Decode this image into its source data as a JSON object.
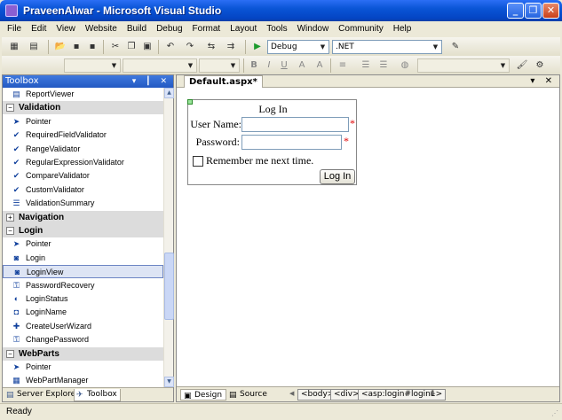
{
  "window": {
    "title": "PraveenAlwar - Microsoft Visual Studio",
    "minimize": "_",
    "maximize": "❐",
    "close": "✕"
  },
  "menu": [
    "File",
    "Edit",
    "View",
    "Website",
    "Build",
    "Debug",
    "Format",
    "Layout",
    "Tools",
    "Window",
    "Community",
    "Help"
  ],
  "toolbar": {
    "config_value": "Debug",
    "platform_value": ".NET",
    "bold": "B",
    "italic": "I",
    "underline": "U"
  },
  "toolbox": {
    "title": "Toolbox",
    "header_icons": "▾ ┃ ✕",
    "rows": [
      {
        "kind": "item",
        "label": "ReportViewer",
        "icon": "table-icon"
      },
      {
        "kind": "group",
        "label": "Validation",
        "expanded": true
      },
      {
        "kind": "item",
        "label": "Pointer",
        "icon": "pointer-icon"
      },
      {
        "kind": "item",
        "label": "RequiredFieldValidator",
        "icon": "validator-icon"
      },
      {
        "kind": "item",
        "label": "RangeValidator",
        "icon": "validator-icon"
      },
      {
        "kind": "item",
        "label": "RegularExpressionValidator",
        "icon": "validator-icon"
      },
      {
        "kind": "item",
        "label": "CompareValidator",
        "icon": "validator-icon"
      },
      {
        "kind": "item",
        "label": "CustomValidator",
        "icon": "validator-icon"
      },
      {
        "kind": "item",
        "label": "ValidationSummary",
        "icon": "summary-icon"
      },
      {
        "kind": "group",
        "label": "Navigation",
        "expanded": false
      },
      {
        "kind": "group",
        "label": "Login",
        "expanded": true
      },
      {
        "kind": "item",
        "label": "Pointer",
        "icon": "pointer-icon"
      },
      {
        "kind": "item",
        "label": "Login",
        "icon": "login-icon"
      },
      {
        "kind": "item",
        "label": "LoginView",
        "icon": "login-icon",
        "selected": true
      },
      {
        "kind": "item",
        "label": "PasswordRecovery",
        "icon": "password-icon"
      },
      {
        "kind": "item",
        "label": "LoginStatus",
        "icon": "status-icon"
      },
      {
        "kind": "item",
        "label": "LoginName",
        "icon": "name-icon"
      },
      {
        "kind": "item",
        "label": "CreateUserWizard",
        "icon": "wizard-icon"
      },
      {
        "kind": "item",
        "label": "ChangePassword",
        "icon": "password-icon"
      },
      {
        "kind": "group",
        "label": "WebParts",
        "expanded": true
      },
      {
        "kind": "item",
        "label": "Pointer",
        "icon": "pointer-icon"
      },
      {
        "kind": "item",
        "label": "WebPartManager",
        "icon": "webpart-icon"
      }
    ],
    "tabs": {
      "server_explorer": "Server Explorer",
      "toolbox": "Toolbox"
    }
  },
  "document": {
    "tab_label": "Default.aspx*",
    "tab_icons": "▾ ✕",
    "login_control": {
      "title": "Log In",
      "username_label": "User Name:",
      "password_label": "Password:",
      "required_marker": "*",
      "remember_label": "Remember me next time.",
      "button_label": "Log In"
    },
    "views": {
      "design": "Design",
      "source": "Source"
    },
    "breadcrumbs": [
      "<body>",
      "<div>",
      "<asp:login#login1>"
    ]
  },
  "status": {
    "text": "Ready"
  }
}
